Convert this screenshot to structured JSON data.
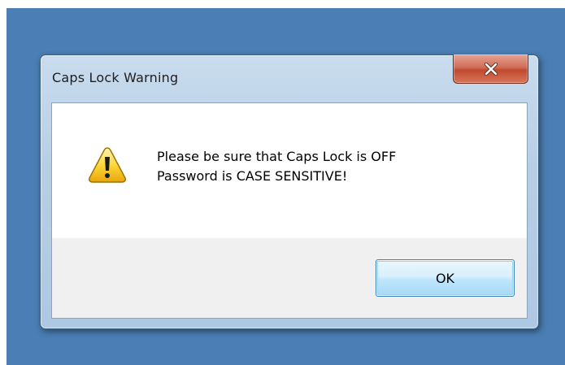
{
  "dialog": {
    "title": "Caps Lock Warning",
    "close_glyph": "x",
    "icon": "warning-icon",
    "message_lines": [
      "Please be sure that Caps Lock is OFF",
      "Password is CASE SENSITIVE!"
    ],
    "ok_label": "OK"
  },
  "colors": {
    "desktop": "#4a7eb4",
    "frame": "#b7cfe6",
    "close_button": "#c14a30",
    "button_area": "#f0f0f0",
    "ok_button_border": "#3c7fb1"
  }
}
